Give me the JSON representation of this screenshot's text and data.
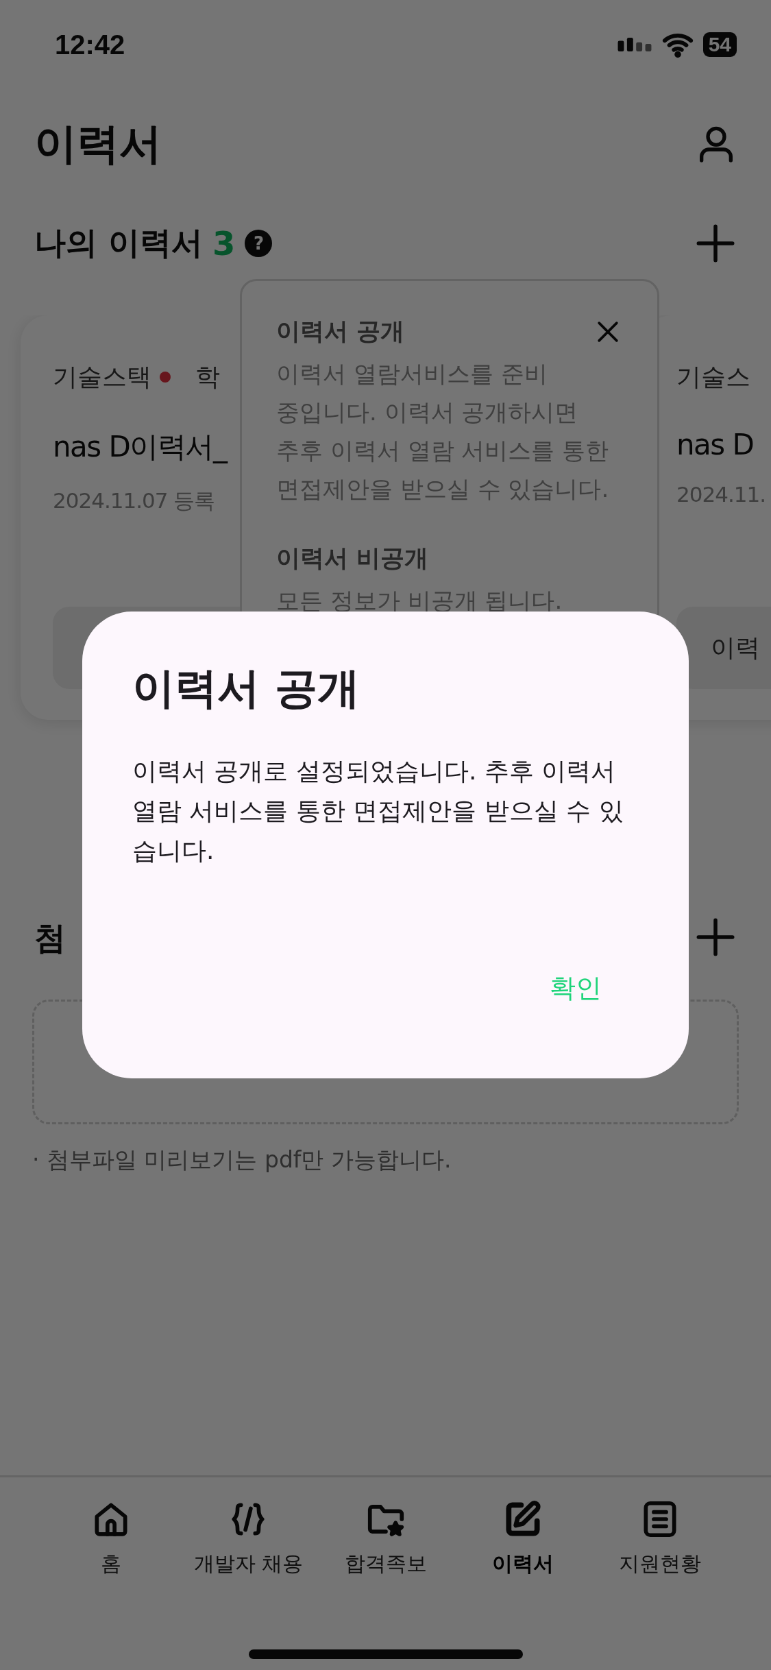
{
  "status_bar": {
    "time": "12:42",
    "battery": "54"
  },
  "header": {
    "title": "이력서"
  },
  "my_resumes": {
    "title": "나의 이력서",
    "count": "3",
    "help": "?"
  },
  "cards": [
    {
      "tags": [
        {
          "label": "기술스택",
          "dot": true
        },
        {
          "label": "학",
          "dot": false
        }
      ],
      "title": "nas D이력서_",
      "date": "2024.11.07 등록"
    },
    {
      "tags": [
        {
          "label": "기술스",
          "dot": false
        }
      ],
      "title": "nas D",
      "date": "2024.11.",
      "button": "이력"
    }
  ],
  "tooltip": {
    "title": "이력서 공개",
    "body": "이력서 열람서비스를 준비 중입니다. 이력서 공개하시면 추후 이력서 열람 서비스를 통한 면접제안을 받으실 수 있습니다.",
    "title_2": "이력서 비공개",
    "body_2": "모든 정보가 비공개 됩니다."
  },
  "attachments": {
    "title": "첨",
    "note": "· 첨부파일 미리보기는 pdf만 가능합니다."
  },
  "dialog": {
    "title": "이력서 공개",
    "message": "이력서 공개로 설정되었습니다. 추후 이력서 열람 서비스를 통한 면접제안을 받으실 수 있습니다.",
    "confirm": "확인"
  },
  "tabs": [
    {
      "label": "홈",
      "kind": "home",
      "selected": false
    },
    {
      "label": "개발자 채용",
      "kind": "code",
      "selected": false
    },
    {
      "label": "합격족보",
      "kind": "folder",
      "selected": false
    },
    {
      "label": "이력서",
      "kind": "edit",
      "selected": true
    },
    {
      "label": "지원현황",
      "kind": "list",
      "selected": false
    }
  ]
}
